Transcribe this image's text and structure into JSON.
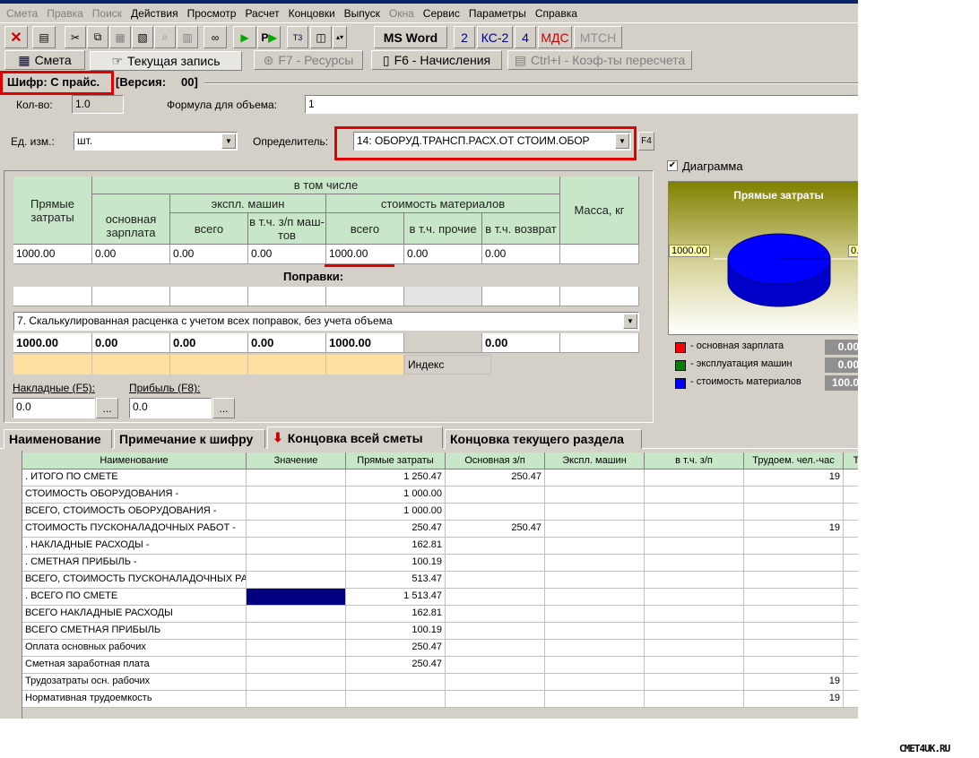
{
  "menu": [
    {
      "label": "Смета",
      "disabled": true
    },
    {
      "label": "Правка",
      "disabled": true
    },
    {
      "label": "Поиск",
      "disabled": true
    },
    {
      "label": "Действия"
    },
    {
      "label": "Просмотр"
    },
    {
      "label": "Расчет"
    },
    {
      "label": "Концовки"
    },
    {
      "label": "Выпуск"
    },
    {
      "label": "Окна",
      "disabled": true
    },
    {
      "label": "Сервис"
    },
    {
      "label": "Параметры"
    },
    {
      "label": "Справка"
    }
  ],
  "toolbar": {
    "msword": "MS Word",
    "b2": "2",
    "ks2": "КС-2",
    "b4": "4",
    "mds": "МДС",
    "mtsn": "МТСН",
    "t3": "T3",
    "p": "P"
  },
  "tabs": {
    "smeta": "Смета",
    "current": "Текущая запись",
    "resources": "F7 - Ресурсы",
    "charges": "F6 - Начисления",
    "coefs": "Ctrl+I - Коэф-ты пересчета"
  },
  "header": {
    "cipher": "Шифр: С прайс.",
    "version_label": "[Версия:",
    "version": "00]"
  },
  "form": {
    "qty_label": "Кол-во:",
    "qty": "1.0",
    "formula_label": "Формула для объема:",
    "formula": "1",
    "unit_label": "Ед. изм.:",
    "unit": "шт.",
    "determinant_label": "Определитель:",
    "determinant": "14: ОБОРУД.ТРАНСП.РАСХ.ОТ СТОИМ.ОБОР",
    "f4": "F4"
  },
  "grid": {
    "h_direct": "Прямые затраты",
    "h_incl": "в том числе",
    "h_base": "основная зарплата",
    "h_mach": "экспл. машин",
    "h_mach_all": "всего",
    "h_mach_zp": "в т.ч. з/п маш-тов",
    "h_mat": "стоимость материалов",
    "h_mat_all": "всего",
    "h_mat_other": "в т.ч. прочие",
    "h_mat_ret": "в т.ч. возврат",
    "h_mass": "Масса, кг",
    "row": [
      "1000.00",
      "0.00",
      "0.00",
      "0.00",
      "1000.00",
      "0.00",
      "0.00",
      ""
    ],
    "corrections_label": "Поправки:",
    "calc_select": "7. Скалькулированная расценка с учетом всех поправок, без учета объема",
    "calc_row": [
      "1000.00",
      "0.00",
      "0.00",
      "0.00",
      "1000.00",
      "",
      "0.00",
      ""
    ],
    "index_label": "Индекс",
    "overhead_label": "Накладные (F5):",
    "overhead": "0.0",
    "profit_label": "Прибыль (F8):",
    "profit": "0.0",
    "dots": "..."
  },
  "diagram": {
    "checkbox_label": "Диаграмма",
    "title": "Прямые затраты",
    "label_left": "1000.00",
    "label_right": "0.",
    "legend": [
      {
        "label": "- основная зарплата",
        "value": "0.00",
        "color": "#ff0000"
      },
      {
        "label": "- эксплуатация машин",
        "value": "0.00",
        "color": "#008000"
      },
      {
        "label": "- стоимость материалов",
        "value": "100.0",
        "color": "#0000ff"
      }
    ]
  },
  "bottom_tabs": [
    "Наименование",
    "Примечание к шифру",
    "Концовка всей сметы",
    "Концовка текущего раздела"
  ],
  "table": {
    "columns": [
      "Наименование",
      "Значение",
      "Прямые затраты",
      "Основная з/п",
      "Экспл. машин",
      "в т.ч. з/п",
      "Трудоем. чел.-час",
      "Т"
    ],
    "rows": [
      [
        ".   ИТОГО  ПО  СМЕТЕ",
        "",
        "1 250.47",
        "250.47",
        "",
        "",
        "19"
      ],
      [
        "СТОИМОСТЬ ОБОРУДОВАНИЯ -",
        "",
        "1 000.00",
        "",
        "",
        "",
        ""
      ],
      [
        "ВСЕГО, СТОИМОСТЬ ОБОРУДОВАНИЯ -",
        "",
        "1 000.00",
        "",
        "",
        "",
        ""
      ],
      [
        "СТОИМОСТЬ ПУСКОНАЛАДОЧНЫХ РАБОТ -",
        "",
        "250.47",
        "250.47",
        "",
        "",
        "19"
      ],
      [
        ".   НАКЛАДНЫЕ РАСХОДЫ -",
        "",
        "162.81",
        "",
        "",
        "",
        ""
      ],
      [
        ".   СМЕТНАЯ ПРИБЫЛЬ -",
        "",
        "100.19",
        "",
        "",
        "",
        ""
      ],
      [
        "ВСЕГО, СТОИМОСТЬ ПУСКОНАЛАДОЧНЫХ РАБОТ -",
        "",
        "513.47",
        "",
        "",
        "",
        ""
      ],
      [
        ". ВСЕГО  ПО  СМЕТЕ",
        "",
        "1 513.47",
        "",
        "",
        "",
        ""
      ],
      [
        "ВСЕГО НАКЛАДНЫЕ РАСХОДЫ",
        "",
        "162.81",
        "",
        "",
        "",
        ""
      ],
      [
        "ВСЕГО СМЕТНАЯ ПРИБЫЛЬ",
        "",
        "100.19",
        "",
        "",
        "",
        ""
      ],
      [
        "Оплата основных рабочих",
        "",
        "250.47",
        "",
        "",
        "",
        ""
      ],
      [
        "Сметная заработная плата",
        "",
        "250.47",
        "",
        "",
        "",
        ""
      ],
      [
        "Трудозатраты осн. рабочих",
        "",
        "",
        "",
        "",
        "",
        "19"
      ],
      [
        "Нормативная трудоемкость",
        "",
        "",
        "",
        "",
        "",
        "19"
      ]
    ]
  },
  "watermark": "CMET4UK.RU"
}
